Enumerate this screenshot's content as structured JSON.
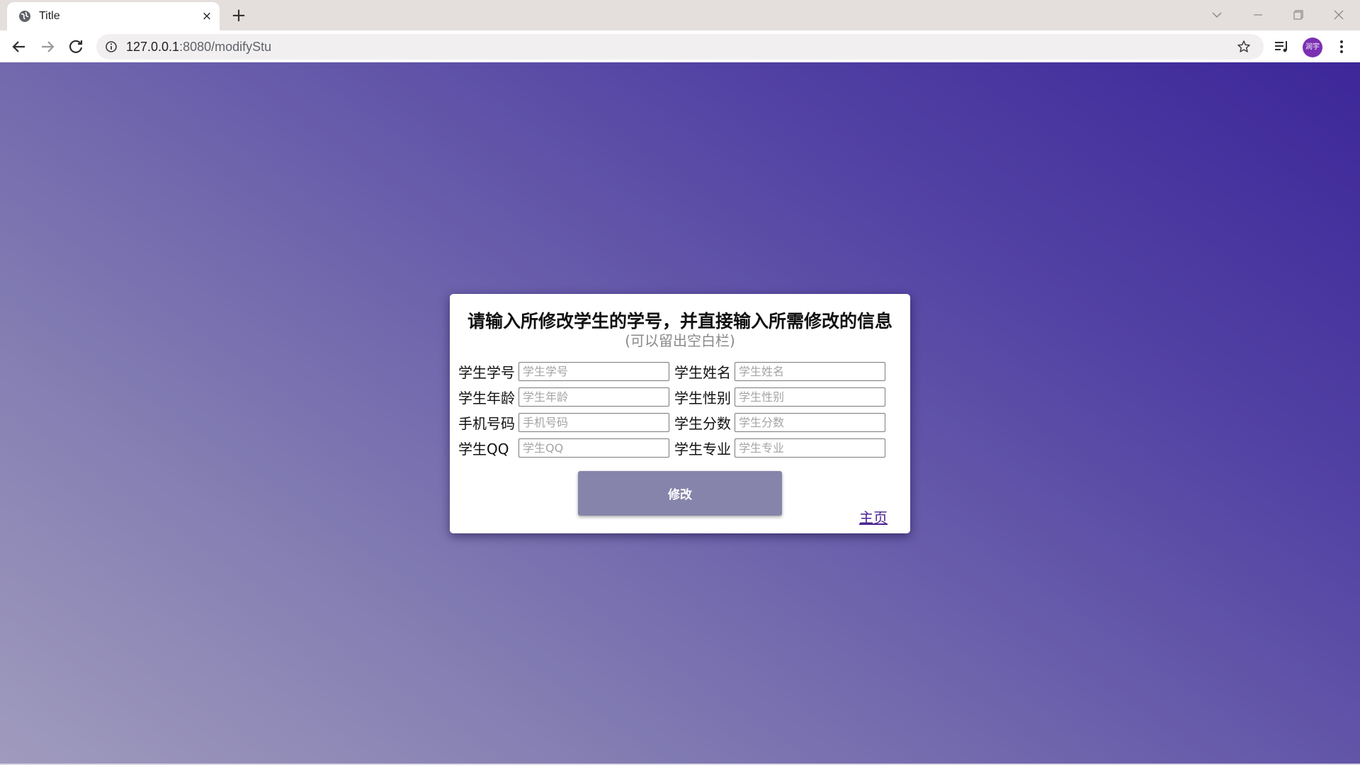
{
  "browser": {
    "tab_title": "Title",
    "tab_close": "×",
    "new_tab": "+",
    "url_host": "127.0.0.1",
    "url_rest": ":8080/modifyStu",
    "avatar_text": "润宇"
  },
  "page": {
    "title": "请输入所修改学生的学号，并直接输入所需修改的信息",
    "subtitle": "(可以留出空白栏)",
    "fields": [
      {
        "label": "学生学号",
        "placeholder": "学生学号",
        "value": ""
      },
      {
        "label": "学生姓名",
        "placeholder": "学生姓名",
        "value": ""
      },
      {
        "label": "学生年龄",
        "placeholder": "学生年龄",
        "value": ""
      },
      {
        "label": "学生性别",
        "placeholder": "学生性别",
        "value": ""
      },
      {
        "label": "手机号码",
        "placeholder": "手机号码",
        "value": ""
      },
      {
        "label": "学生分数",
        "placeholder": "学生分数",
        "value": ""
      },
      {
        "label": "学生QQ",
        "placeholder": "学生QQ",
        "value": ""
      },
      {
        "label": "学生专业",
        "placeholder": "学生专业",
        "value": ""
      }
    ],
    "submit_label": "修改",
    "home_link": "主页"
  },
  "colors": {
    "tabstrip": "#e4dedd",
    "gradient_start": "#a09bbd",
    "gradient_end": "#3d2799",
    "button": "#8784ab",
    "link": "#4b2591",
    "avatar": "#7b2fb3"
  }
}
